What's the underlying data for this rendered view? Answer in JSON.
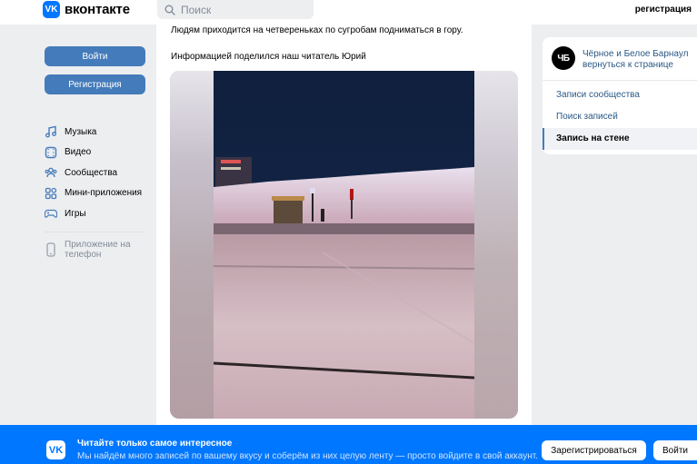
{
  "header": {
    "logo_glyph": "VK",
    "logo_text": "вконтакте",
    "search_placeholder": "Поиск",
    "register_link": "регистрация"
  },
  "sidebar": {
    "login_button": "Войти",
    "register_button": "Регистрация",
    "items": [
      {
        "label": "Музыка",
        "icon": "music-icon"
      },
      {
        "label": "Видео",
        "icon": "video-icon"
      },
      {
        "label": "Сообщества",
        "icon": "communities-icon"
      },
      {
        "label": "Мини-приложения",
        "icon": "mini-apps-icon"
      },
      {
        "label": "Игры",
        "icon": "games-icon"
      }
    ],
    "app_promo": "Приложение на телефон"
  },
  "post": {
    "line1": "Людям приходится на четвереньках по сугробам подниматься в гору.",
    "line2": "Информацией поделился наш читатель Юрий"
  },
  "right_panel": {
    "group_avatar": "ЧБ",
    "group_name": "Чёрное и Белое Барнаул",
    "group_back": "вернуться к странице",
    "menu": [
      {
        "label": "Записи сообщества",
        "active": false
      },
      {
        "label": "Поиск записей",
        "active": false
      },
      {
        "label": "Запись на стене",
        "active": true
      }
    ]
  },
  "banner": {
    "logo_glyph": "VK",
    "title": "Читайте только самое интересное",
    "subtitle": "Мы найдём много записей по вашему вкусу и соберём из них целую ленту — просто войдите в свой аккаунт.",
    "register_button": "Зарегистрироваться",
    "login_button": "Войти"
  },
  "colors": {
    "brand": "#0077ff",
    "button": "#447bba",
    "link": "#2a5885",
    "background": "#edeef0"
  }
}
